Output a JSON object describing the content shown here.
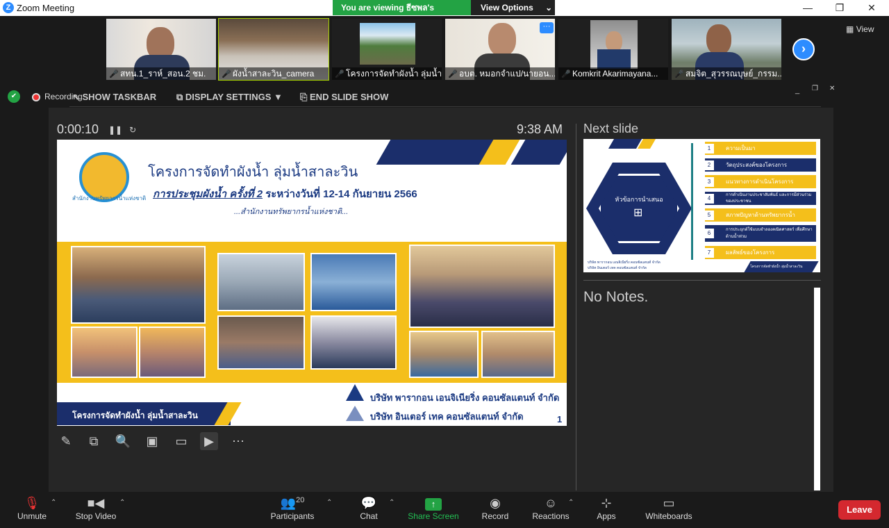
{
  "window": {
    "title": "Zoom Meeting",
    "minimize": "—",
    "restore": "❐",
    "close": "✕"
  },
  "share_banner": {
    "text": "You are viewing ธีซพล's screen",
    "view_options": "View Options"
  },
  "participants_strip": [
    {
      "name": "สทน.1_ราห์_สอน.2 ชม."
    },
    {
      "name": "ผังน้ำสาละวิน_camera"
    },
    {
      "name": "โครงการจัดทำผังน้ำ ลุ่มน้ำ..."
    },
    {
      "name": "อบต. หมอกจำแป/นายอน..."
    },
    {
      "name": "Komkrit Akarimayana..."
    },
    {
      "name": "สมจิต_สุวรรณบุษย์_กรรม..."
    }
  ],
  "view_button": "View",
  "presenter_bar": {
    "recording": "Recording",
    "show_taskbar": "SHOW TASKBAR",
    "display_settings": "DISPLAY SETTINGS ▼",
    "end_slide_show": "END SLIDE SHOW"
  },
  "presenter": {
    "timer": "0:00:10",
    "clock": "9:38 AM",
    "next_slide_label": "Next slide",
    "notes": "No Notes."
  },
  "slide": {
    "title": "โครงการจัดทำผังน้ำ ลุ่มน้ำสาละวิน",
    "subtitle_prefix": "การประชุมผังน้ำ ครั้งที่ 2",
    "subtitle_rest": " ระหว่างวันที่ 12-14 กันยายน 2566",
    "organizer": "...สำนักงานทรัพยากรน้ำแห่งชาติ...",
    "logo_caption": "สำนักงานทรัพยากรน้ำแห่งชาติ",
    "footer": "โครงการจัดทำผังน้ำ ลุ่มน้ำสาละวิน",
    "company_1": "บริษัท พารากอน เอนจิเนียริ่ง คอนซัลแตนท์ จำกัด",
    "company_2": "บริษัท อินเตอร์ เทค คอนซัลแตนท์ จำกัด",
    "page": "1"
  },
  "next_slide": {
    "center_title": "หัวข้อการนำเสนอ",
    "items": [
      {
        "num": "1",
        "label": "ความเป็นมา"
      },
      {
        "num": "2",
        "label": "วัตถุประสงค์ของโครงการ"
      },
      {
        "num": "3",
        "label": "แนวทางการดำเนินโครงการ"
      },
      {
        "num": "4",
        "label": "การดำเนินงานประชาสัมพันธ์ และการมีส่วนร่วมของประชาชน"
      },
      {
        "num": "5",
        "label": "สภาพปัญหาด้านทรัพยากรน้ำ"
      },
      {
        "num": "6",
        "label": "การประยุกต์ใช้แบบจำลองคณิตศาสตร์ เพื่อศึกษาด้านน้ำท่วม"
      },
      {
        "num": "7",
        "label": "ผลลัพธ์ของโครงการ"
      }
    ],
    "footer_left_1": "บริษัท พารากอน เอนจิเนียริ่ง คอนซัลแตนท์ จำกัด",
    "footer_left_2": "บริษัท อินเตอร์ เทค คอนซัลแตนท์ จำกัด",
    "footer_right": "โครงการจัดทำผังน้ำ ลุ่มน้ำสาละวิน"
  },
  "bottom_bar": {
    "unmute": "Unmute",
    "stop_video": "Stop Video",
    "participants": "Participants",
    "participants_count": "20",
    "chat": "Chat",
    "share_screen": "Share Screen",
    "record": "Record",
    "reactions": "Reactions",
    "apps": "Apps",
    "whiteboards": "Whiteboards",
    "leave": "Leave"
  },
  "colors": {
    "accent": "#2d8cff",
    "share_green": "#23a344",
    "leave_red": "#d4282f",
    "slide_navy": "#1b2e6b",
    "slide_gold": "#f4bf1b"
  }
}
